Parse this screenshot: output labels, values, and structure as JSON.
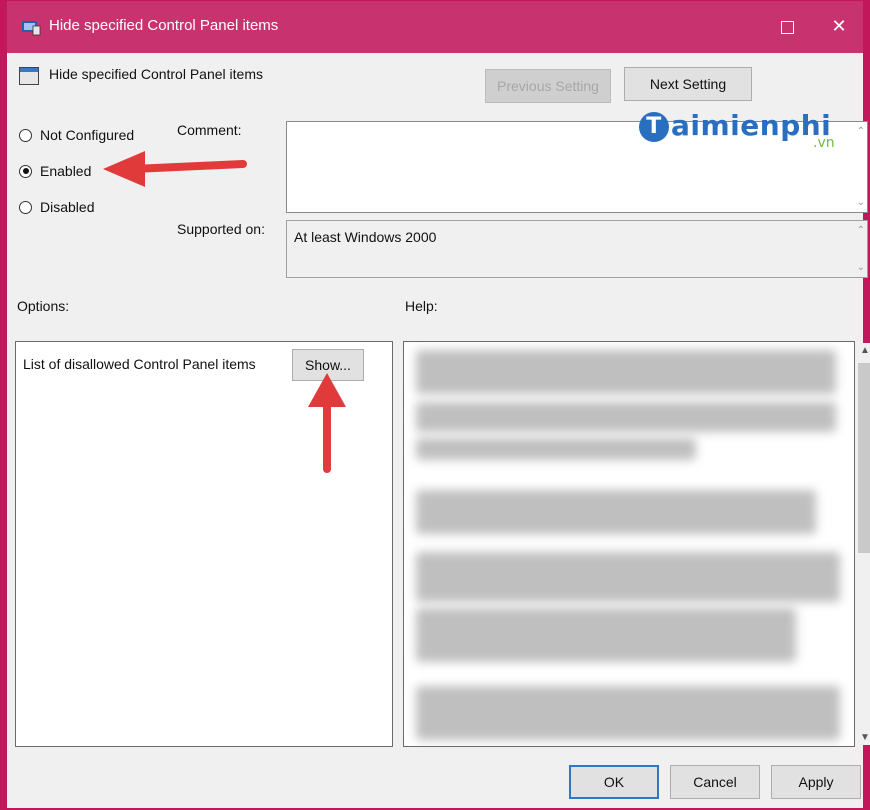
{
  "window": {
    "title": "Hide specified Control Panel items",
    "title_bar_color": "#c8336f",
    "controls": {
      "maximize_icon": "maximize-icon",
      "close_glyph": "✕"
    }
  },
  "policy": {
    "name": "Hide specified Control Panel items",
    "prev_button": "Previous Setting",
    "next_button": "Next Setting"
  },
  "state": {
    "options": [
      {
        "label": "Not Configured",
        "selected": false
      },
      {
        "label": "Enabled",
        "selected": true
      },
      {
        "label": "Disabled",
        "selected": false
      }
    ]
  },
  "comment": {
    "label": "Comment:",
    "value": ""
  },
  "supported": {
    "label": "Supported on:",
    "value": "At least Windows 2000"
  },
  "options_section": {
    "label": "Options:",
    "item_label": "List of disallowed Control Panel items",
    "show_button": "Show..."
  },
  "help_section": {
    "label": "Help:"
  },
  "footer": {
    "ok": "OK",
    "cancel": "Cancel",
    "apply": "Apply"
  },
  "watermark": {
    "main": "aimienphi",
    "initial": "T",
    "sub": ".vn",
    "color": "#2a6fbf",
    "sub_color": "#6cbf3a"
  },
  "annotations": {
    "arrow_color": "#e03a3a"
  }
}
